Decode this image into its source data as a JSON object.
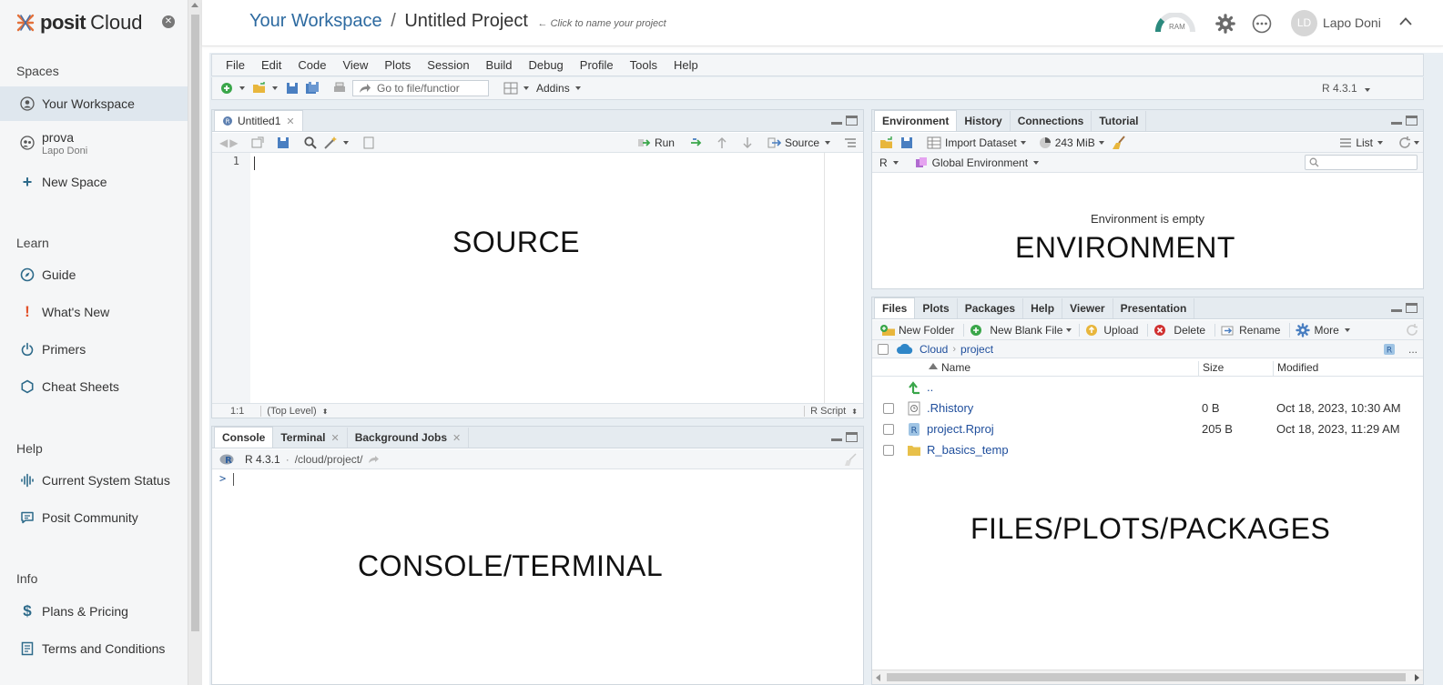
{
  "sidebar": {
    "brand_posit": "posit",
    "brand_cloud": "Cloud",
    "spaces_heading": "Spaces",
    "spaces": [
      {
        "label": "Your Workspace",
        "sub": ""
      },
      {
        "label": "prova",
        "sub": "Lapo Doni"
      },
      {
        "label": "New Space",
        "sub": ""
      }
    ],
    "learn_heading": "Learn",
    "learn": [
      "Guide",
      "What's New",
      "Primers",
      "Cheat Sheets"
    ],
    "help_heading": "Help",
    "help": [
      "Current System Status",
      "Posit Community"
    ],
    "info_heading": "Info",
    "info": [
      "Plans & Pricing",
      "Terms and Conditions"
    ]
  },
  "header": {
    "workspace": "Your Workspace",
    "separator": "/",
    "project": "Untitled Project",
    "hint": "← Click to name your project",
    "ram_label": "RAM",
    "avatar_initials": "LD",
    "username": "Lapo Doni"
  },
  "menubar": [
    "File",
    "Edit",
    "Code",
    "View",
    "Plots",
    "Session",
    "Build",
    "Debug",
    "Profile",
    "Tools",
    "Help"
  ],
  "toolbar": {
    "goto_placeholder": "Go to file/functior",
    "addins": "Addins",
    "r_version": "R 4.3.1"
  },
  "source": {
    "tab": "Untitled1",
    "run": "Run",
    "source": "Source",
    "line_number": "1",
    "position": "1:1",
    "scope": "(Top Level)",
    "file_type": "R Script",
    "overlay": "SOURCE"
  },
  "console": {
    "tabs": [
      "Console",
      "Terminal",
      "Background Jobs"
    ],
    "r_version": "R 4.3.1",
    "dot": "·",
    "path": "/cloud/project/",
    "prompt": ">",
    "overlay": "CONSOLE/TERMINAL"
  },
  "environment": {
    "tabs": [
      "Environment",
      "History",
      "Connections",
      "Tutorial"
    ],
    "import_dataset": "Import Dataset",
    "memory": "243 MiB",
    "list": "List",
    "lang": "R",
    "scope": "Global Environment",
    "empty_message": "Environment is empty",
    "overlay": "ENVIRONMENT"
  },
  "files": {
    "tabs": [
      "Files",
      "Plots",
      "Packages",
      "Help",
      "Viewer",
      "Presentation"
    ],
    "new_folder": "New Folder",
    "new_blank_file": "New Blank File",
    "upload": "Upload",
    "delete": "Delete",
    "rename": "Rename",
    "more": "More",
    "path_root": "Cloud",
    "path_sub": "project",
    "ellipsis": "...",
    "col_name": "Name",
    "col_size": "Size",
    "col_modified": "Modified",
    "up": "..",
    "rows": [
      {
        "name": ".Rhistory",
        "size": "0 B",
        "modified": "Oct 18, 2023, 10:30 AM"
      },
      {
        "name": "project.Rproj",
        "size": "205 B",
        "modified": "Oct 18, 2023, 11:29 AM"
      },
      {
        "name": "R_basics_temp",
        "size": "",
        "modified": ""
      }
    ],
    "overlay": "FILES/PLOTS/PACKAGES"
  }
}
